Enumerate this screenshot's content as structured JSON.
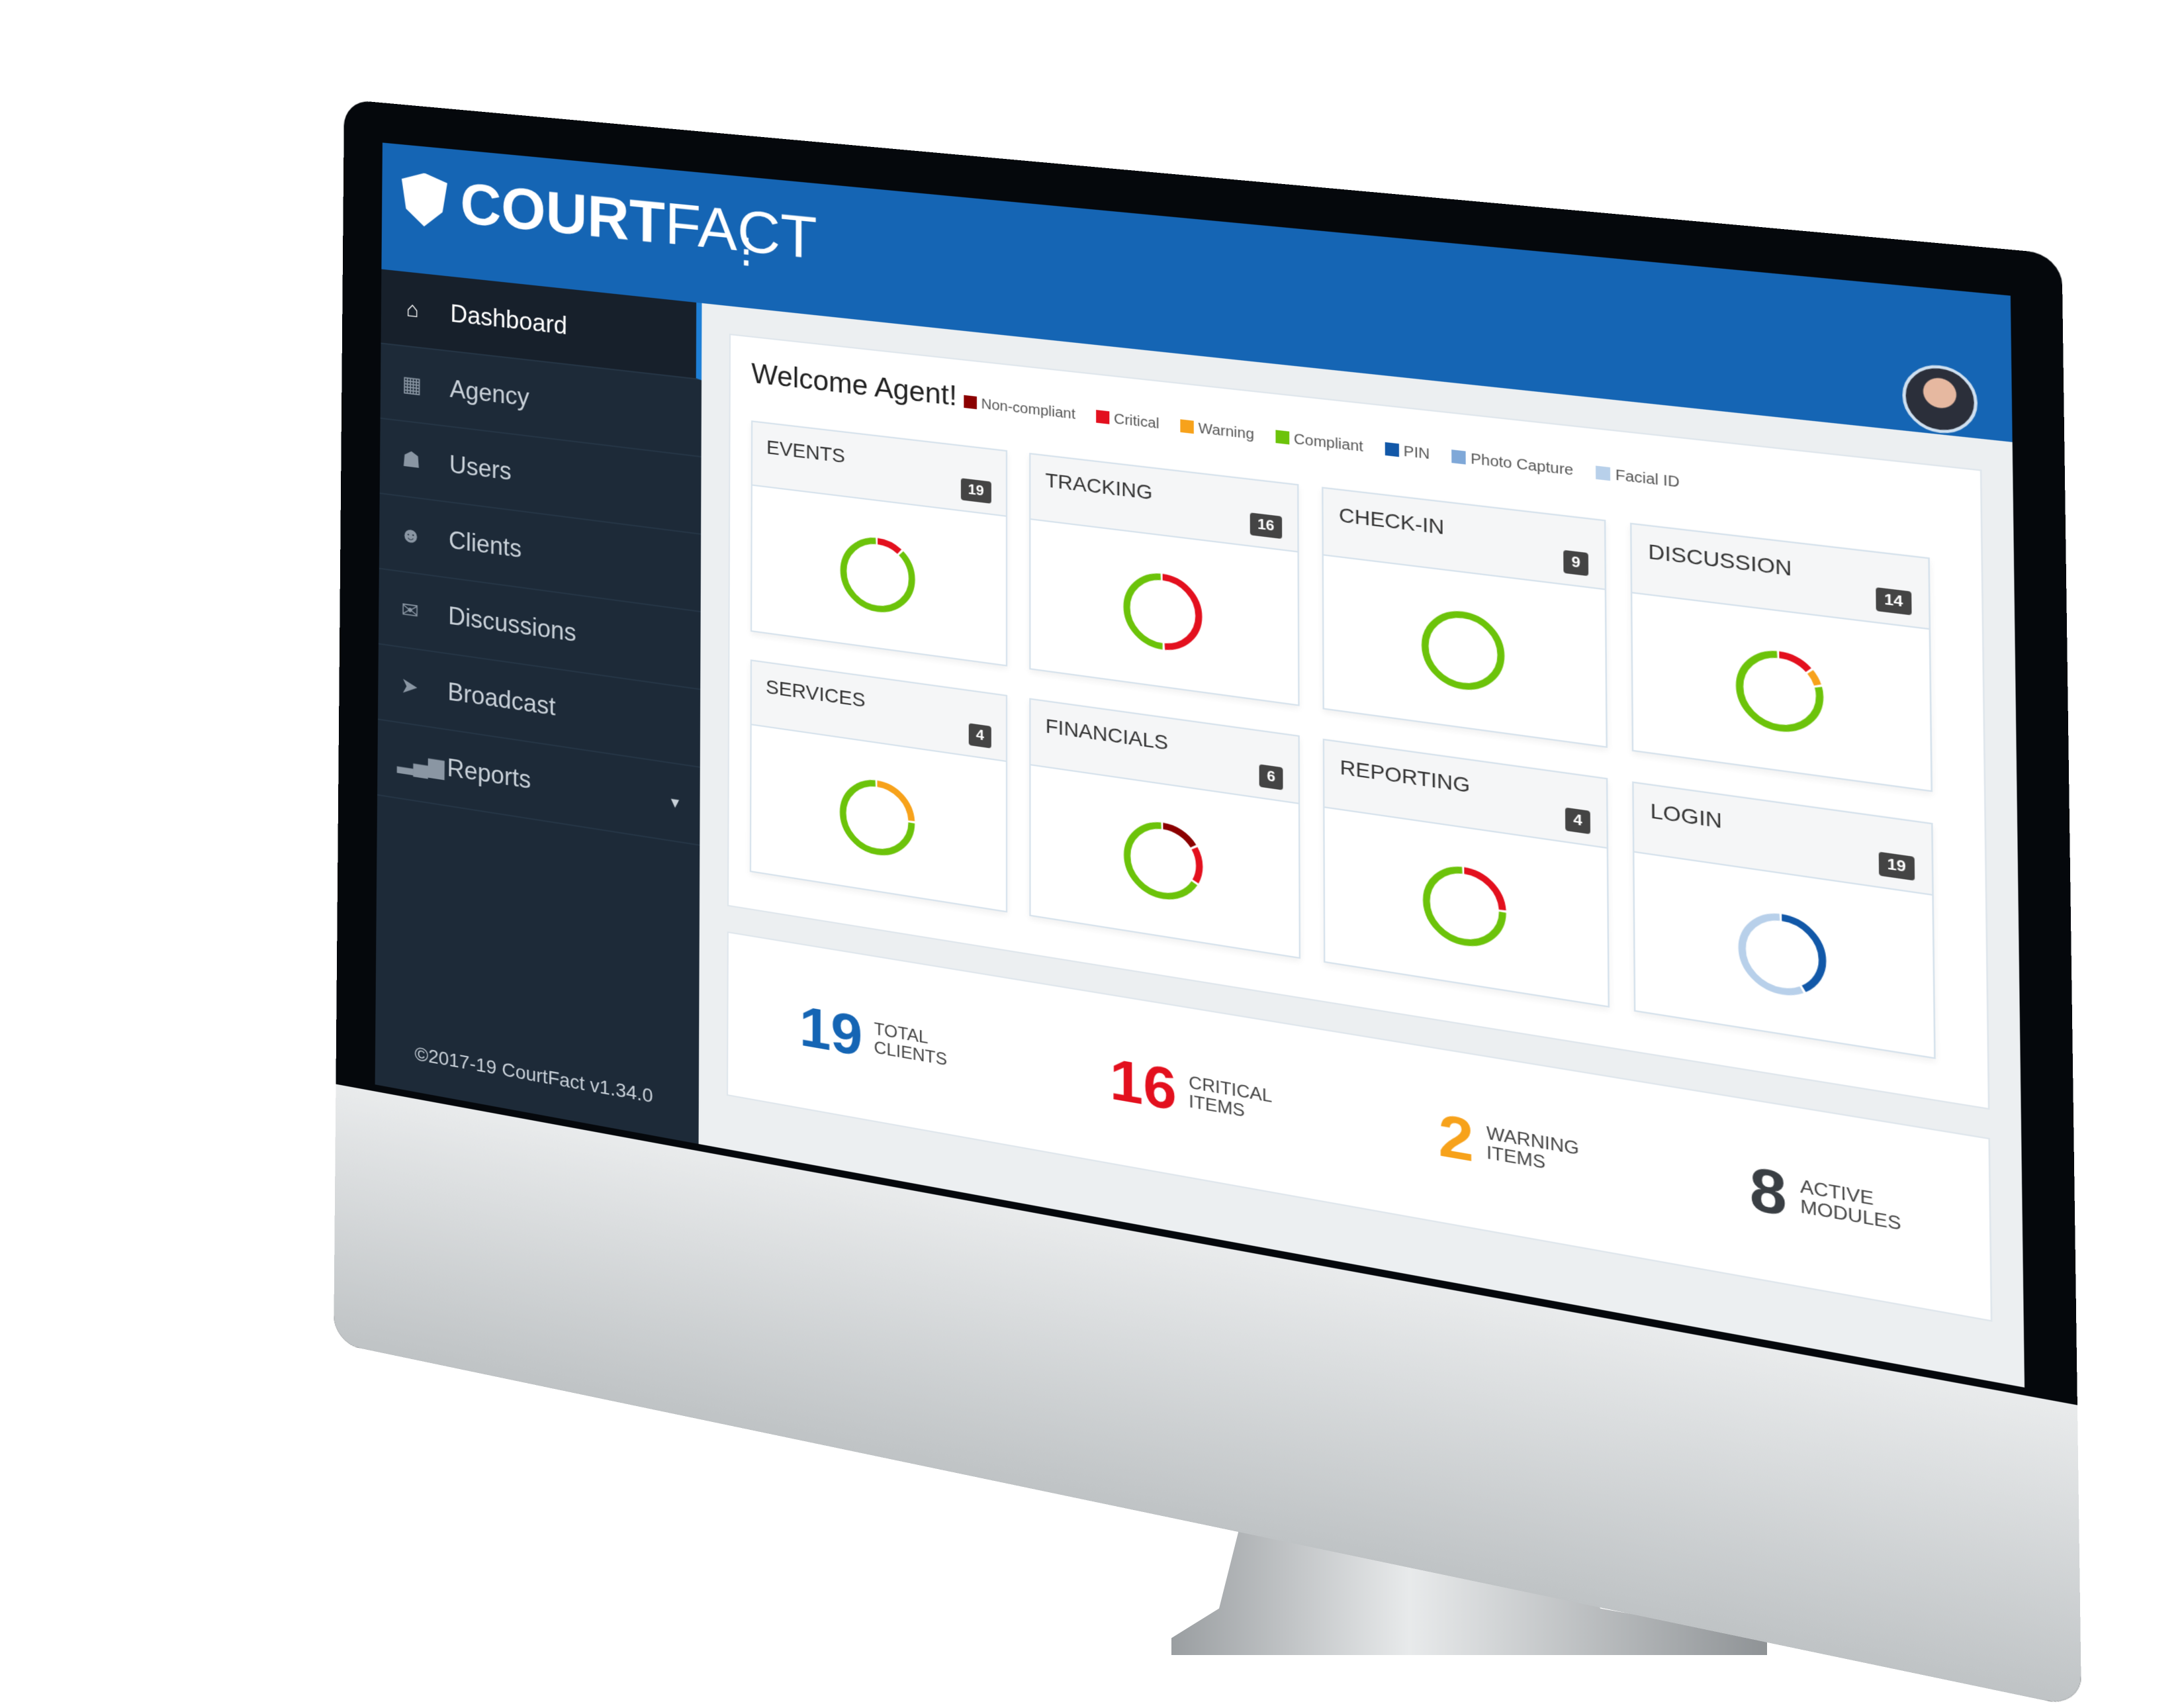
{
  "app": {
    "brand_bold": "COURT",
    "brand_light": "FACT",
    "menu_icon": "kebab-vertical-icon",
    "avatar": "user-avatar-photo"
  },
  "sidebar": {
    "items": [
      {
        "label": "Dashboard",
        "icon": "home-icon",
        "glyph": "⌂",
        "active": true
      },
      {
        "label": "Agency",
        "icon": "building-icon",
        "glyph": "▦",
        "active": false
      },
      {
        "label": "Users",
        "icon": "user-secret-icon",
        "glyph": "☗",
        "active": false
      },
      {
        "label": "Clients",
        "icon": "users-group-icon",
        "glyph": "☻",
        "active": false
      },
      {
        "label": "Discussions",
        "icon": "comments-icon",
        "glyph": "✉",
        "active": false
      },
      {
        "label": "Broadcast",
        "icon": "paper-plane-icon",
        "glyph": "➤",
        "active": false
      },
      {
        "label": "Reports",
        "icon": "signal-bars-icon",
        "glyph": "▂▄▆",
        "active": false,
        "has_submenu": true
      }
    ],
    "caret": "▾",
    "footer": "©2017-19 CourtFact v1.34.0"
  },
  "dashboard": {
    "welcome": "Welcome Agent!",
    "legend": [
      {
        "label": "Non-compliant",
        "color": "#8b0000"
      },
      {
        "label": "Critical",
        "color": "#e3101e"
      },
      {
        "label": "Warning",
        "color": "#f7a21b"
      },
      {
        "label": "Compliant",
        "color": "#6cc30a"
      },
      {
        "label": "PIN",
        "color": "#1258a8"
      },
      {
        "label": "Photo Capture",
        "color": "#7fa8d8"
      },
      {
        "label": "Facial ID",
        "color": "#b8d0ea"
      }
    ],
    "modules": [
      {
        "title": "EVENTS",
        "count": "19"
      },
      {
        "title": "TRACKING",
        "count": "16"
      },
      {
        "title": "CHECK-IN",
        "count": "9"
      },
      {
        "title": "DISCUSSION",
        "count": "14"
      },
      {
        "title": "SERVICES",
        "count": "4"
      },
      {
        "title": "FINANCIALS",
        "count": "6"
      },
      {
        "title": "REPORTING",
        "count": "4"
      },
      {
        "title": "LOGIN",
        "count": "19"
      }
    ],
    "stats": [
      {
        "value": "19",
        "line1": "TOTAL",
        "line2": "CLIENTS",
        "color": "#1565b4"
      },
      {
        "value": "16",
        "line1": "CRITICAL",
        "line2": "ITEMS",
        "color": "#e3101e"
      },
      {
        "value": "2",
        "line1": "WARNING",
        "line2": "ITEMS",
        "color": "#f7a21b"
      },
      {
        "value": "8",
        "line1": "ACTIVE",
        "line2": "MODULES",
        "color": "#3a3f44"
      }
    ]
  },
  "chart_data": [
    {
      "type": "pie",
      "title": "EVENTS",
      "series": [
        {
          "name": "Critical",
          "value": 0.12
        },
        {
          "name": "Compliant",
          "value": 0.88
        }
      ]
    },
    {
      "type": "pie",
      "title": "TRACKING",
      "series": [
        {
          "name": "Critical",
          "value": 0.5
        },
        {
          "name": "Compliant",
          "value": 0.5
        }
      ]
    },
    {
      "type": "pie",
      "title": "CHECK-IN",
      "series": [
        {
          "name": "Compliant",
          "value": 1.0
        }
      ]
    },
    {
      "type": "pie",
      "title": "DISCUSSION",
      "series": [
        {
          "name": "Critical",
          "value": 0.14
        },
        {
          "name": "Warning",
          "value": 0.07
        },
        {
          "name": "Compliant",
          "value": 0.79
        }
      ]
    },
    {
      "type": "pie",
      "title": "SERVICES",
      "series": [
        {
          "name": "Warning",
          "value": 0.25
        },
        {
          "name": "Compliant",
          "value": 0.75
        }
      ]
    },
    {
      "type": "pie",
      "title": "FINANCIALS",
      "series": [
        {
          "name": "Non-compliant",
          "value": 0.167
        },
        {
          "name": "Critical",
          "value": 0.167
        },
        {
          "name": "Compliant",
          "value": 0.666
        }
      ]
    },
    {
      "type": "pie",
      "title": "REPORTING",
      "series": [
        {
          "name": "Critical",
          "value": 0.25
        },
        {
          "name": "Compliant",
          "value": 0.75
        }
      ]
    },
    {
      "type": "pie",
      "title": "LOGIN",
      "series": [
        {
          "name": "PIN",
          "value": 0.42
        },
        {
          "name": "Facial ID",
          "value": 0.58
        }
      ]
    }
  ]
}
